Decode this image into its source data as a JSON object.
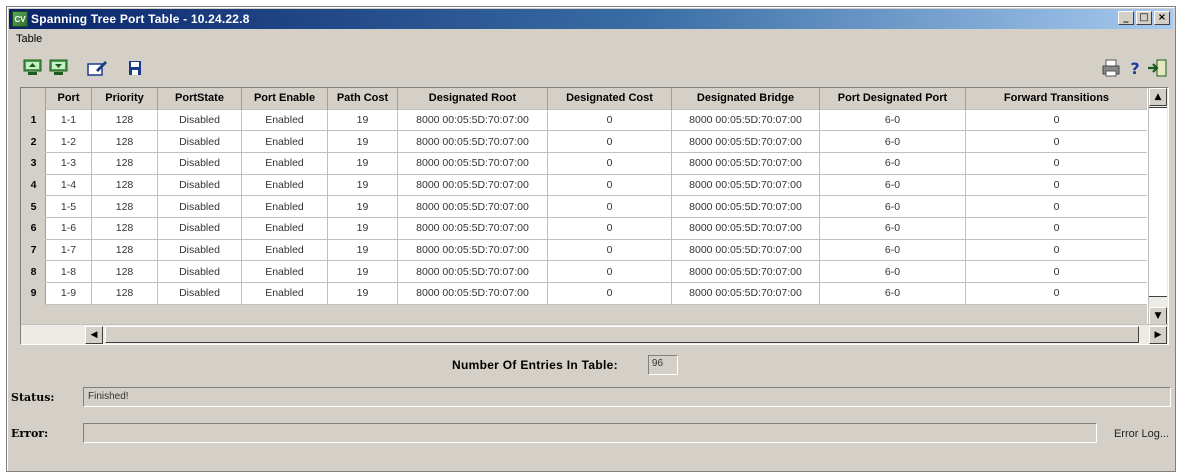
{
  "window": {
    "title": "Spanning Tree Port Table - 10.24.22.8",
    "app_icon": "CV",
    "controls": [
      "_",
      "□",
      "×"
    ]
  },
  "menu": [
    {
      "label": "Table"
    }
  ],
  "toolbar": {
    "left_icons": [
      "upload-icon",
      "download-icon",
      "edit-icon",
      "save-icon"
    ],
    "right_icons": [
      "print-icon",
      "help-icon",
      "exit-icon"
    ]
  },
  "table": {
    "columns": [
      "",
      "Port",
      "Priority",
      "PortState",
      "Port Enable",
      "Path Cost",
      "Designated Root",
      "Designated Cost",
      "Designated Bridge",
      "Port Designated Port",
      "Forward Transitions"
    ],
    "rows": [
      [
        "1",
        "1-1",
        "128",
        "Disabled",
        "Enabled",
        "19",
        "8000 00:05:5D:70:07:00",
        "0",
        "8000 00:05:5D:70:07:00",
        "6-0",
        "0"
      ],
      [
        "2",
        "1-2",
        "128",
        "Disabled",
        "Enabled",
        "19",
        "8000 00:05:5D:70:07:00",
        "0",
        "8000 00:05:5D:70:07:00",
        "6-0",
        "0"
      ],
      [
        "3",
        "1-3",
        "128",
        "Disabled",
        "Enabled",
        "19",
        "8000 00:05:5D:70:07:00",
        "0",
        "8000 00:05:5D:70:07:00",
        "6-0",
        "0"
      ],
      [
        "4",
        "1-4",
        "128",
        "Disabled",
        "Enabled",
        "19",
        "8000 00:05:5D:70:07:00",
        "0",
        "8000 00:05:5D:70:07:00",
        "6-0",
        "0"
      ],
      [
        "5",
        "1-5",
        "128",
        "Disabled",
        "Enabled",
        "19",
        "8000 00:05:5D:70:07:00",
        "0",
        "8000 00:05:5D:70:07:00",
        "6-0",
        "0"
      ],
      [
        "6",
        "1-6",
        "128",
        "Disabled",
        "Enabled",
        "19",
        "8000 00:05:5D:70:07:00",
        "0",
        "8000 00:05:5D:70:07:00",
        "6-0",
        "0"
      ],
      [
        "7",
        "1-7",
        "128",
        "Disabled",
        "Enabled",
        "19",
        "8000 00:05:5D:70:07:00",
        "0",
        "8000 00:05:5D:70:07:00",
        "6-0",
        "0"
      ],
      [
        "8",
        "1-8",
        "128",
        "Disabled",
        "Enabled",
        "19",
        "8000 00:05:5D:70:07:00",
        "0",
        "8000 00:05:5D:70:07:00",
        "6-0",
        "0"
      ],
      [
        "9",
        "1-9",
        "128",
        "Disabled",
        "Enabled",
        "19",
        "8000 00:05:5D:70:07:00",
        "0",
        "8000 00:05:5D:70:07:00",
        "6-0",
        "0"
      ]
    ]
  },
  "entries": {
    "label": "Number Of Entries In Table:",
    "value": "96"
  },
  "status": {
    "label": "Status:",
    "value": "Finished!"
  },
  "error": {
    "label": "Error:",
    "value": "",
    "log_button": "Error Log..."
  }
}
